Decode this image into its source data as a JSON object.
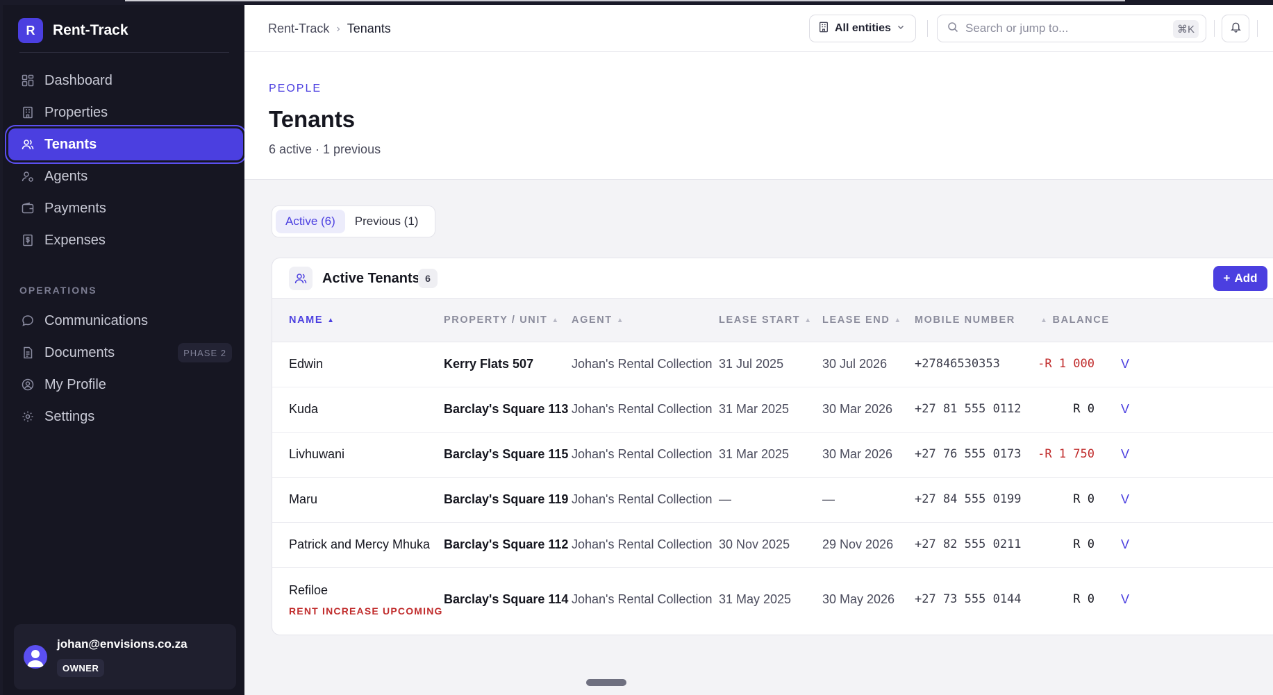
{
  "app": {
    "logo_letter": "R",
    "name": "Rent-Track"
  },
  "sidebar": {
    "items": [
      {
        "label": "Dashboard",
        "icon": "dashboard-icon"
      },
      {
        "label": "Properties",
        "icon": "building-icon"
      },
      {
        "label": "Tenants",
        "icon": "users-icon",
        "active": true
      },
      {
        "label": "Agents",
        "icon": "agent-icon"
      },
      {
        "label": "Payments",
        "icon": "wallet-icon"
      },
      {
        "label": "Expenses",
        "icon": "receipt-icon"
      }
    ],
    "section_label": "OPERATIONS",
    "ops_items": [
      {
        "label": "Communications",
        "icon": "chat-icon"
      },
      {
        "label": "Documents",
        "icon": "document-icon",
        "badge": "PHASE 2"
      },
      {
        "label": "My Profile",
        "icon": "profile-icon"
      },
      {
        "label": "Settings",
        "icon": "gear-icon"
      }
    ],
    "user": {
      "email": "johan@envisions.co.za",
      "role": "OWNER"
    }
  },
  "topbar": {
    "breadcrumb": [
      "Rent-Track",
      "Tenants"
    ],
    "entities_label": "All entities",
    "search_placeholder": "Search or jump to...",
    "search_shortcut": "⌘K"
  },
  "header": {
    "eyebrow": "PEOPLE",
    "title": "Tenants",
    "subtitle": "6 active · 1 previous"
  },
  "tabs": [
    {
      "label": "Active (6)",
      "active": true
    },
    {
      "label": "Previous (1)",
      "active": false
    }
  ],
  "table": {
    "title": "Active Tenants",
    "count": "6",
    "add_label": "Add",
    "columns": [
      "NAME",
      "PROPERTY / UNIT",
      "AGENT",
      "LEASE START",
      "LEASE END",
      "MOBILE NUMBER",
      "BALANCE"
    ],
    "rows": [
      {
        "name": "Edwin",
        "property": "Kerry Flats 507",
        "agent": "Johan's Rental Collection",
        "lease_start": "31 Jul 2025",
        "lease_end": "30 Jul 2026",
        "mobile": "+27846530353",
        "balance": "-R 1 000",
        "action": "V"
      },
      {
        "name": "Kuda",
        "property": "Barclay's Square 113",
        "agent": "Johan's Rental Collection",
        "lease_start": "31 Mar 2025",
        "lease_end": "30 Mar 2026",
        "mobile": "+27 81 555 0112",
        "balance": "R 0",
        "action": "V"
      },
      {
        "name": "Livhuwani",
        "property": "Barclay's Square 115",
        "agent": "Johan's Rental Collection",
        "lease_start": "31 Mar 2025",
        "lease_end": "30 Mar 2026",
        "mobile": "+27 76 555 0173",
        "balance": "-R 1 750",
        "action": "V"
      },
      {
        "name": "Maru",
        "property": "Barclay's Square 119",
        "agent": "Johan's Rental Collection",
        "lease_start": "—",
        "lease_end": "—",
        "mobile": "+27 84 555 0199",
        "balance": "R 0",
        "action": "V"
      },
      {
        "name": "Patrick and Mercy Mhuka",
        "property": "Barclay's Square 112",
        "agent": "Johan's Rental Collection",
        "lease_start": "30 Nov 2025",
        "lease_end": "29 Nov 2026",
        "mobile": "+27 82 555 0211",
        "balance": "R 0",
        "action": "V"
      },
      {
        "name": "Refiloe",
        "flag": "RENT INCREASE UPCOMING",
        "property": "Barclay's Square 114",
        "agent": "Johan's Rental Collection",
        "lease_start": "31 May 2025",
        "lease_end": "30 May 2026",
        "mobile": "+27 73 555 0144",
        "balance": "R 0",
        "action": "V"
      }
    ]
  },
  "colors": {
    "accent": "#4b3fe0",
    "sidebar_bg": "#161622",
    "negative": "#c02b2b"
  }
}
